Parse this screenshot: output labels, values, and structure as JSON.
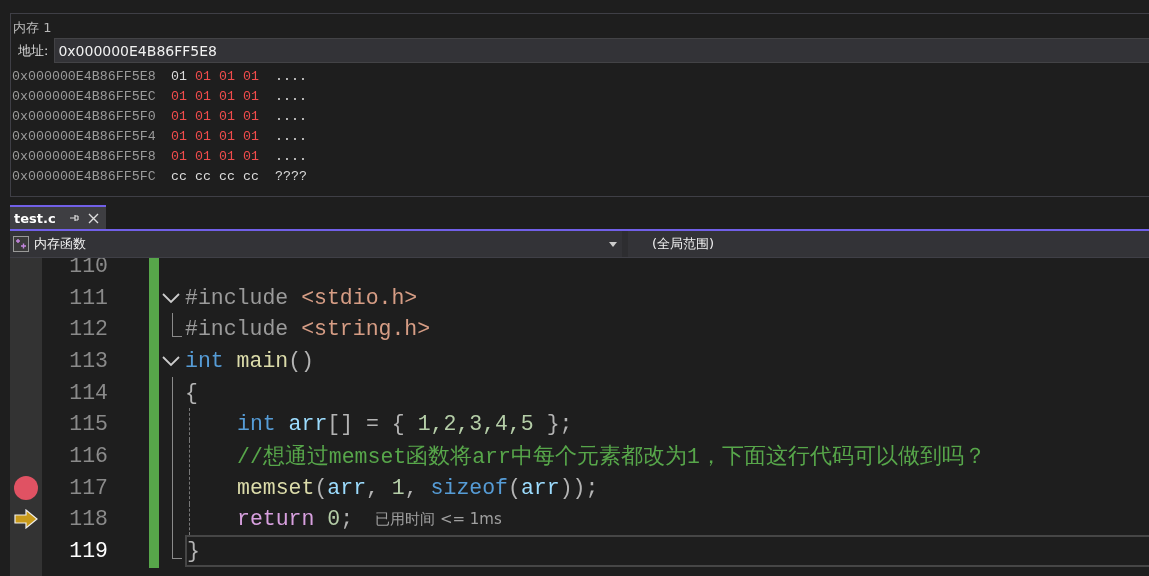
{
  "memory": {
    "title": "内存 1",
    "address_label": "地址:",
    "address": "0x000000E4B86FF5E8",
    "rows": [
      {
        "address": "0x000000E4B86FF5E8",
        "bytes": [
          {
            "text": "01",
            "changed": false
          },
          {
            "text": "01",
            "changed": true
          },
          {
            "text": "01",
            "changed": true
          },
          {
            "text": "01",
            "changed": true
          }
        ],
        "ascii": "...."
      },
      {
        "address": "0x000000E4B86FF5EC",
        "bytes": [
          {
            "text": "01",
            "changed": true
          },
          {
            "text": "01",
            "changed": true
          },
          {
            "text": "01",
            "changed": true
          },
          {
            "text": "01",
            "changed": true
          }
        ],
        "ascii": "...."
      },
      {
        "address": "0x000000E4B86FF5F0",
        "bytes": [
          {
            "text": "01",
            "changed": true
          },
          {
            "text": "01",
            "changed": true
          },
          {
            "text": "01",
            "changed": true
          },
          {
            "text": "01",
            "changed": true
          }
        ],
        "ascii": "...."
      },
      {
        "address": "0x000000E4B86FF5F4",
        "bytes": [
          {
            "text": "01",
            "changed": true
          },
          {
            "text": "01",
            "changed": true
          },
          {
            "text": "01",
            "changed": true
          },
          {
            "text": "01",
            "changed": true
          }
        ],
        "ascii": "...."
      },
      {
        "address": "0x000000E4B86FF5F8",
        "bytes": [
          {
            "text": "01",
            "changed": true
          },
          {
            "text": "01",
            "changed": true
          },
          {
            "text": "01",
            "changed": true
          },
          {
            "text": "01",
            "changed": true
          }
        ],
        "ascii": "...."
      },
      {
        "address": "0x000000E4B86FF5FC",
        "bytes": [
          {
            "text": "cc",
            "changed": false
          },
          {
            "text": "cc",
            "changed": false
          },
          {
            "text": "cc",
            "changed": false
          },
          {
            "text": "cc",
            "changed": false
          }
        ],
        "ascii": "????"
      }
    ]
  },
  "tabs": [
    {
      "label": "test.c",
      "selected": true
    }
  ],
  "nav": {
    "scope": "内存函数",
    "member": "(全局范围)"
  },
  "lines": [
    {
      "number": "110",
      "selected": false
    },
    {
      "number": "111",
      "selected": false,
      "collapsible": true,
      "tokens": [
        {
          "kind": "preproc",
          "text": "#include "
        },
        {
          "kind": "string",
          "text": "<stdio.h>"
        }
      ]
    },
    {
      "number": "112",
      "selected": false,
      "in_block": true,
      "tokens": [
        {
          "kind": "preproc",
          "text": "#include "
        },
        {
          "kind": "string",
          "text": "<string.h>"
        }
      ]
    },
    {
      "number": "113",
      "selected": false,
      "collapsible": true,
      "tokens": [
        {
          "kind": "keyword",
          "text": "int "
        },
        {
          "kind": "function",
          "text": "main"
        },
        {
          "kind": "punct",
          "text": "()"
        }
      ]
    },
    {
      "number": "114",
      "selected": false,
      "in_block": true,
      "tokens": [
        {
          "kind": "punct",
          "text": "{"
        }
      ]
    },
    {
      "number": "115",
      "selected": false,
      "in_block": true,
      "indented": true,
      "tokens": [
        {
          "kind": "keyword",
          "text": "int "
        },
        {
          "kind": "variable",
          "text": "arr"
        },
        {
          "kind": "punct",
          "text": "[] = { "
        },
        {
          "kind": "number",
          "text": "1,2,3,4,5"
        },
        {
          "kind": "punct",
          "text": " };"
        }
      ]
    },
    {
      "number": "116",
      "selected": false,
      "in_block": true,
      "indented": true,
      "tokens": [
        {
          "kind": "comment",
          "text": "//想通过memset函数将arr中每个元素都改为1，下面这行代码可以做到吗？"
        }
      ]
    },
    {
      "number": "117",
      "selected": false,
      "in_block": true,
      "indented": true,
      "breakpoint": true,
      "tokens": [
        {
          "kind": "function",
          "text": "memset"
        },
        {
          "kind": "punct",
          "text": "("
        },
        {
          "kind": "variable",
          "text": "arr"
        },
        {
          "kind": "punct",
          "text": ", "
        },
        {
          "kind": "number",
          "text": "1"
        },
        {
          "kind": "punct",
          "text": ", "
        },
        {
          "kind": "keyword",
          "text": "sizeof"
        },
        {
          "kind": "punct",
          "text": "("
        },
        {
          "kind": "variable",
          "text": "arr"
        },
        {
          "kind": "punct",
          "text": "));"
        }
      ]
    },
    {
      "number": "118",
      "selected": false,
      "in_block": true,
      "indented": true,
      "current_statement": true,
      "hint": "已用时间 <= 1ms",
      "tokens": [
        {
          "kind": "control",
          "text": "return "
        },
        {
          "kind": "number",
          "text": "0"
        },
        {
          "kind": "punct",
          "text": ";"
        }
      ]
    },
    {
      "number": "119",
      "selected": true,
      "in_block": true,
      "tokens": [
        {
          "kind": "punct",
          "text": "}"
        }
      ]
    }
  ]
}
